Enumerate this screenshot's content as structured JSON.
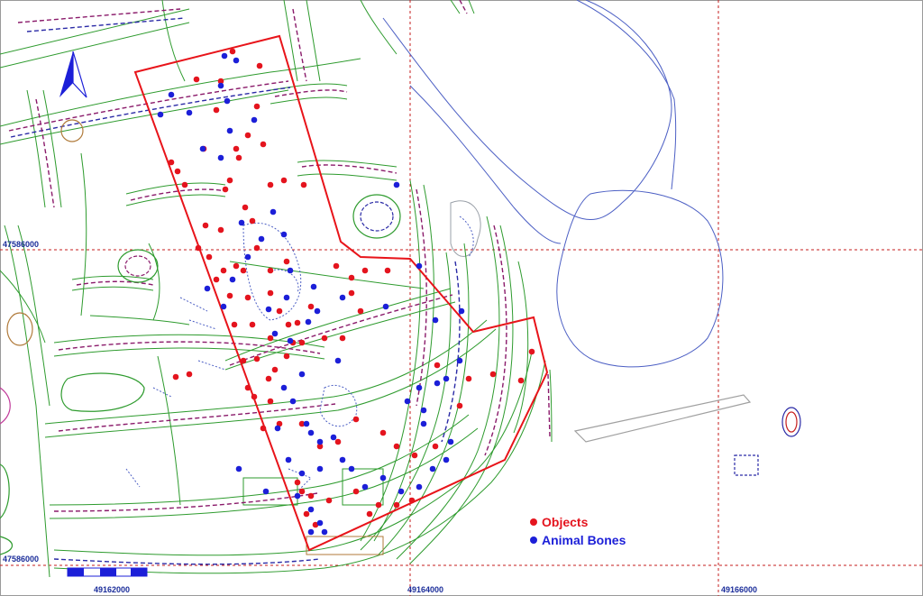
{
  "map": {
    "colors": {
      "objects": "#e4141e",
      "animal_bones": "#1c1fd8",
      "excavation_boundary": "#e8141a",
      "grid": "#c61e1e",
      "ditch_outline": "#2e9b2e",
      "water_contour": "#4c5fc4",
      "coordinate_labels": "#1b2d9a"
    },
    "coordinates": {
      "northing_top": "47586000",
      "northing_bottom": "47586000",
      "easting_left": "49162000",
      "easting_middle": "49164000",
      "easting_right": "49166000"
    },
    "legend": [
      {
        "label": "Objects",
        "color": "#e4141e"
      },
      {
        "label": "Animal Bones",
        "color": "#1c1fd8"
      }
    ],
    "north_arrow_icon": "north-arrow-icon",
    "scale_bar_icon": "scale-bar-icon"
  }
}
